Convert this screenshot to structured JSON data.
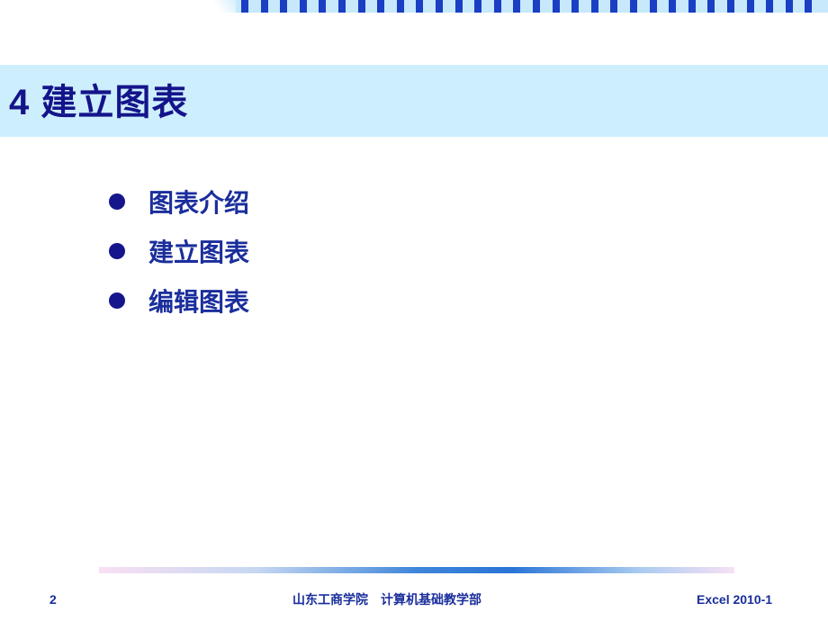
{
  "slide": {
    "title": "4 建立图表",
    "bullets": [
      {
        "label": "图表介绍"
      },
      {
        "label": "建立图表"
      },
      {
        "label": "编辑图表"
      }
    ]
  },
  "footer": {
    "page_number": "2",
    "organization": "山东工商学院　计算机基础教学部",
    "course_label": "Excel 2010-1"
  },
  "colors": {
    "title_band": "#cdeefd",
    "title_text": "#14148a",
    "bullet_text": "#1a2e9c",
    "deco_squares": "#1a3fc4"
  }
}
